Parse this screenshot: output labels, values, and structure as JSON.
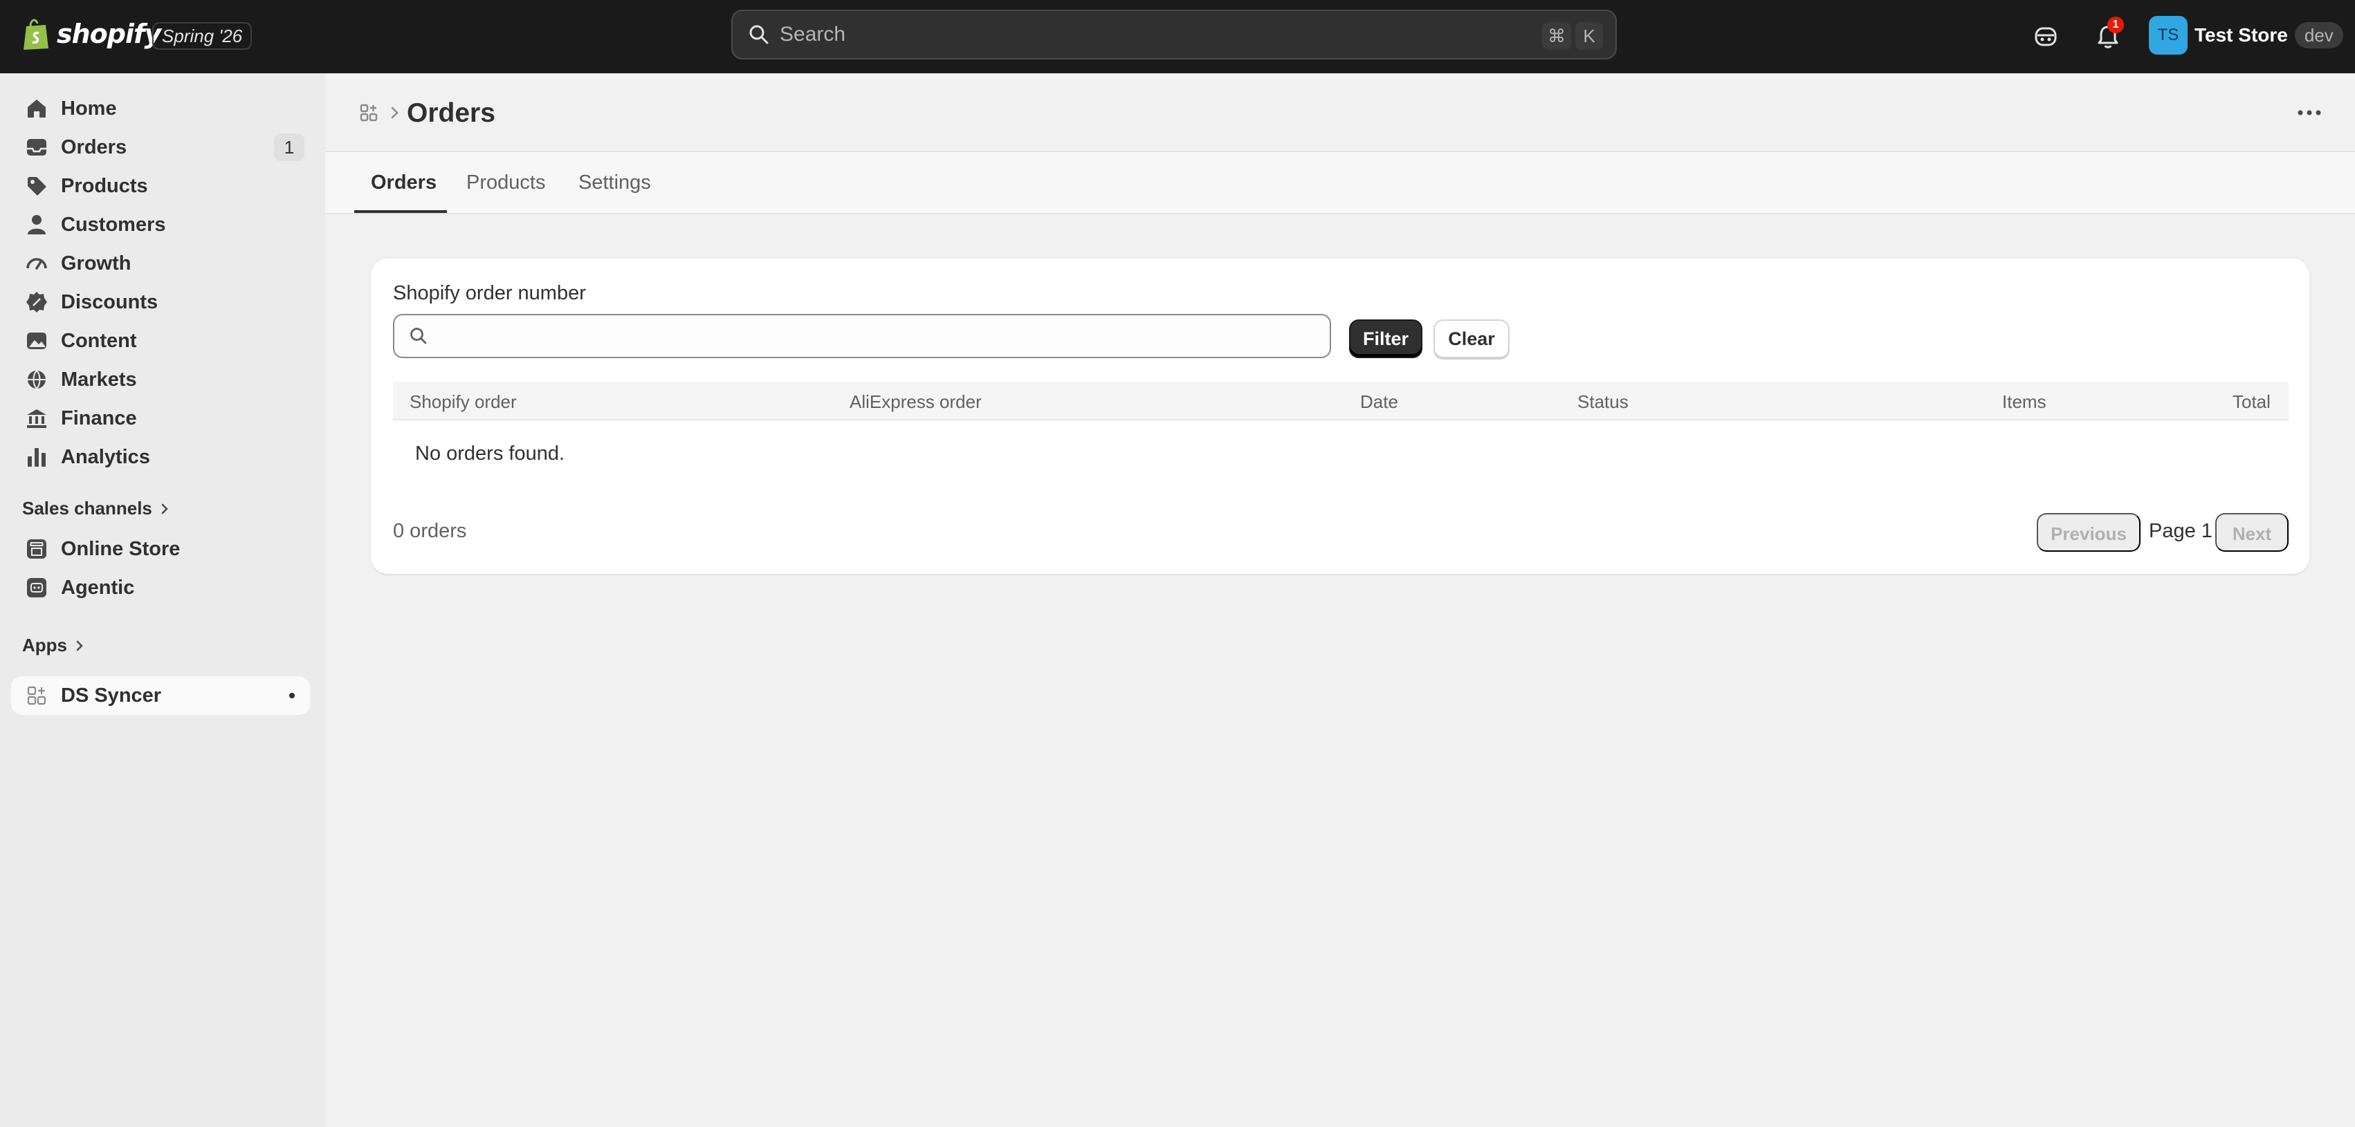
{
  "topbar": {
    "brand": "shopify",
    "edition": "Spring '26",
    "search_placeholder": "Search",
    "shortcut_cmd": "⌘",
    "shortcut_key": "K",
    "notification_count": "1",
    "store_initials": "TS",
    "store_name": "Test Store",
    "store_badge": "dev"
  },
  "sidebar": {
    "items": [
      {
        "label": "Home",
        "icon": "home-icon"
      },
      {
        "label": "Orders",
        "icon": "inbox-icon",
        "badge": "1"
      },
      {
        "label": "Products",
        "icon": "tag-icon"
      },
      {
        "label": "Customers",
        "icon": "person-icon"
      },
      {
        "label": "Growth",
        "icon": "gauge-icon"
      },
      {
        "label": "Discounts",
        "icon": "discount-icon"
      },
      {
        "label": "Content",
        "icon": "content-icon"
      },
      {
        "label": "Markets",
        "icon": "globe-icon"
      },
      {
        "label": "Finance",
        "icon": "bank-icon"
      },
      {
        "label": "Analytics",
        "icon": "bar-chart-icon"
      }
    ],
    "sales_channels_title": "Sales channels",
    "channels": [
      {
        "label": "Online Store",
        "icon": "storefront-icon"
      },
      {
        "label": "Agentic",
        "icon": "robot-icon"
      }
    ],
    "apps_title": "Apps",
    "apps": [
      {
        "label": "DS Syncer",
        "icon": "app-icon"
      }
    ]
  },
  "page": {
    "title": "Orders",
    "tabs": [
      "Orders",
      "Products",
      "Settings"
    ],
    "active_tab": "Orders"
  },
  "filter": {
    "label": "Shopify order number",
    "value": "",
    "filter_label": "Filter",
    "clear_label": "Clear"
  },
  "table": {
    "columns": [
      "Shopify order",
      "AliExpress order",
      "Date",
      "Status",
      "Items",
      "Total"
    ],
    "rows": [],
    "empty_message": "No orders found."
  },
  "pagination": {
    "count_text": "0 orders",
    "previous_label": "Previous",
    "page_text": "Page 1",
    "next_label": "Next"
  },
  "colors": {
    "topbar": "#1a1a1a",
    "sidebar": "#ebebeb",
    "primary_button": "#303030",
    "avatar": "#30a6e3",
    "notification": "#e51c00"
  }
}
